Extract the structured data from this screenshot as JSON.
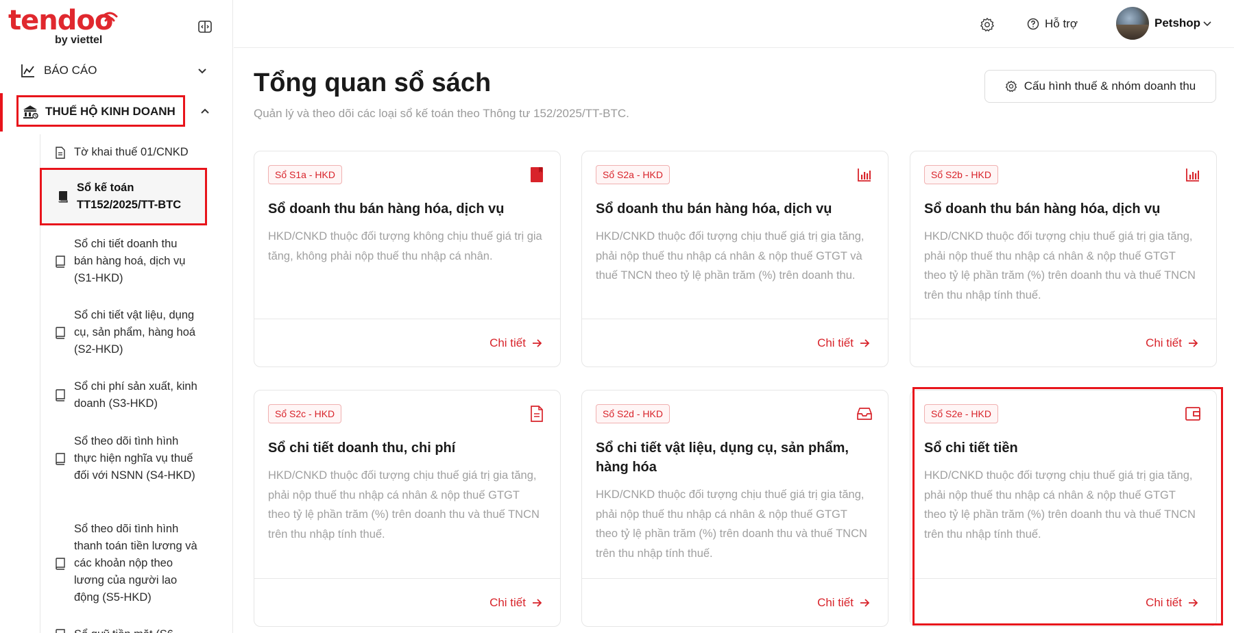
{
  "brand": {
    "name": "tendoo",
    "sub": "by viettel"
  },
  "sidebar": {
    "report_label": "BÁO CÁO",
    "tax_label": "THUẾ HỘ KINH DOANH",
    "items": [
      {
        "label": "Tờ khai thuế 01/CNKD"
      },
      {
        "label": "Sổ kế toán TT152/2025/TT-BTC"
      },
      {
        "label": "Sổ chi tiết doanh thu bán hàng hoá, dịch vụ (S1-HKD)"
      },
      {
        "label": "Sổ chi tiết vật liệu, dụng cụ, sản phẩm, hàng hoá (S2-HKD)"
      },
      {
        "label": "Sổ chi phí sản xuất, kinh doanh (S3-HKD)"
      },
      {
        "label": "Sổ theo dõi tình hình thực hiện nghĩa vụ thuế đối với NSNN (S4-HKD)"
      },
      {
        "label": "Sổ theo dõi tình hình thanh toán tiền lương và các khoản nộp theo lương của người lao động (S5-HKD)"
      },
      {
        "label": "Sổ quỹ tiền mặt (S6"
      }
    ]
  },
  "header": {
    "help_label": "Hỗ trợ",
    "user_name": "Petshop"
  },
  "main": {
    "title": "Tổng quan sổ sách",
    "subtitle": "Quản lý và theo dõi các loại sổ kế toán theo Thông tư 152/2025/TT-BTC.",
    "config_button": "Cấu hình thuế & nhóm doanh thu",
    "detail_label": "Chi tiết",
    "cards": [
      {
        "badge": "Sổ S1a - HKD",
        "title": "Sổ doanh thu bán hàng hóa, dịch vụ",
        "desc": "HKD/CNKD thuộc đối tượng không chịu thuế giá trị gia tăng, không phải nộp thuế thu nhập cá nhân.",
        "icon": "book-icon"
      },
      {
        "badge": "Sổ S2a - HKD",
        "title": "Sổ doanh thu bán hàng hóa, dịch vụ",
        "desc": "HKD/CNKD thuộc đối tượng chịu thuế giá trị gia tăng, phải nộp thuế thu nhập cá nhân & nộp thuế GTGT và thuế TNCN theo tỷ lệ phần trăm (%) trên doanh thu.",
        "icon": "bar-chart-icon"
      },
      {
        "badge": "Sổ S2b - HKD",
        "title": "Sổ doanh thu bán hàng hóa, dịch vụ",
        "desc": "HKD/CNKD thuộc đối tượng chịu thuế giá trị gia tăng, phải nộp thuế thu nhập cá nhân & nộp thuế GTGT theo tỷ lệ phần trăm (%) trên doanh thu và thuế TNCN trên thu nhập tính thuế.",
        "icon": "bar-chart-icon"
      },
      {
        "badge": "Sổ S2c - HKD",
        "title": "Sổ chi tiết doanh thu, chi phí",
        "desc": "HKD/CNKD thuộc đối tượng chịu thuế giá trị gia tăng, phải nộp thuế thu nhập cá nhân & nộp thuế GTGT theo tỷ lệ phần trăm (%) trên doanh thu và thuế TNCN trên thu nhập tính thuế.",
        "icon": "document-icon"
      },
      {
        "badge": "Sổ S2d - HKD",
        "title": "Sổ chi tiết vật liệu, dụng cụ, sản phẩm, hàng hóa",
        "desc": "HKD/CNKD thuộc đối tượng chịu thuế giá trị gia tăng, phải nộp thuế thu nhập cá nhân & nộp thuế GTGT theo tỷ lệ phần trăm (%) trên doanh thu và thuế TNCN trên thu nhập tính thuế.",
        "icon": "inbox-icon"
      },
      {
        "badge": "Sổ S2e - HKD",
        "title": "Sổ chi tiết tiền",
        "desc": "HKD/CNKD thuộc đối tượng chịu thuế giá trị gia tăng, phải nộp thuế thu nhập cá nhân & nộp thuế GTGT theo tỷ lệ phần trăm (%) trên doanh thu và thuế TNCN trên thu nhập tính thuế.",
        "icon": "wallet-icon"
      }
    ]
  },
  "colors": {
    "accent": "#d8232a",
    "highlight": "#e8141b"
  }
}
